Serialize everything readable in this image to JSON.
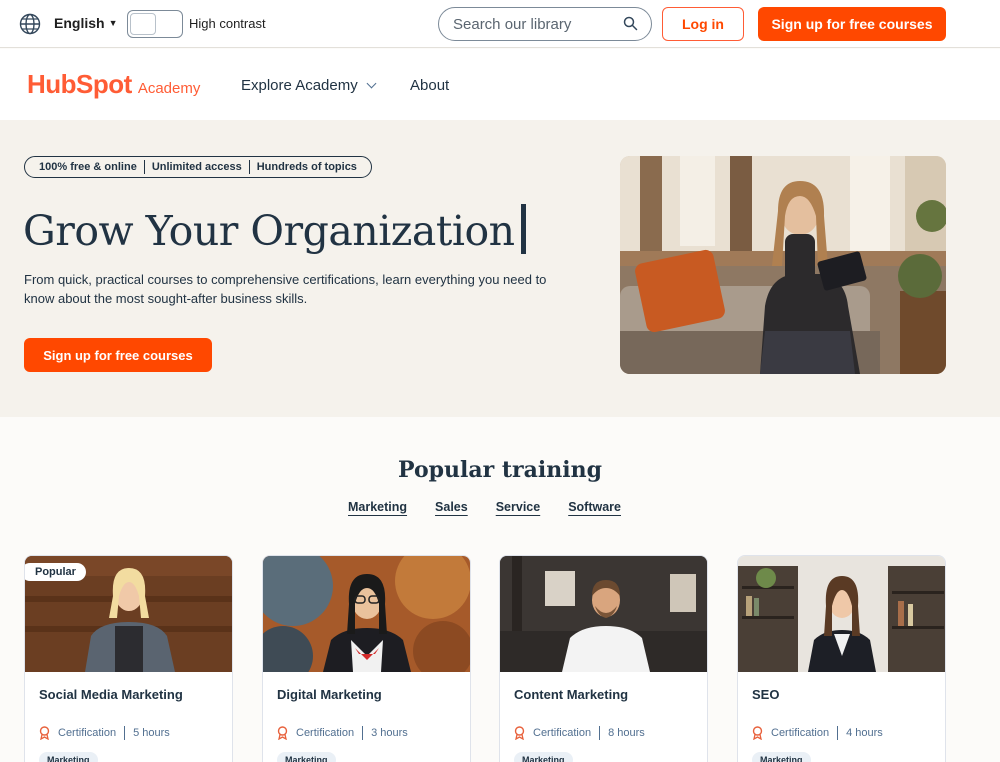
{
  "utility": {
    "language": "English",
    "high_contrast_label": "High contrast",
    "search_placeholder": "Search our library",
    "login_label": "Log in",
    "signup_label": "Sign up for free courses"
  },
  "nav": {
    "logo_text": "HubSpot",
    "logo_sub": "Academy",
    "explore_label": "Explore Academy",
    "about_label": "About"
  },
  "hero": {
    "pills": [
      "100% free & online",
      "Unlimited access",
      "Hundreds of topics"
    ],
    "title": "Grow Your Organization",
    "subtitle": "From quick, practical courses to comprehensive certifications, learn everything you need to know about the most sought-after business skills.",
    "cta_label": "Sign up for free courses"
  },
  "popular": {
    "title": "Popular training",
    "tabs": [
      "Marketing",
      "Sales",
      "Service",
      "Software"
    ],
    "courses": [
      {
        "badge": "Popular",
        "title": "Social Media Marketing",
        "type": "Certification",
        "duration": "5 hours",
        "tag": "Marketing"
      },
      {
        "title": "Digital Marketing",
        "type": "Certification",
        "duration": "3 hours",
        "tag": "Marketing"
      },
      {
        "title": "Content Marketing",
        "type": "Certification",
        "duration": "8 hours",
        "tag": "Marketing"
      },
      {
        "title": "SEO",
        "type": "Certification",
        "duration": "4 hours",
        "tag": "Marketing"
      }
    ]
  },
  "colors": {
    "brand_orange": "#ff4800",
    "navy": "#213343",
    "hero_bg": "#f5f2ec"
  }
}
